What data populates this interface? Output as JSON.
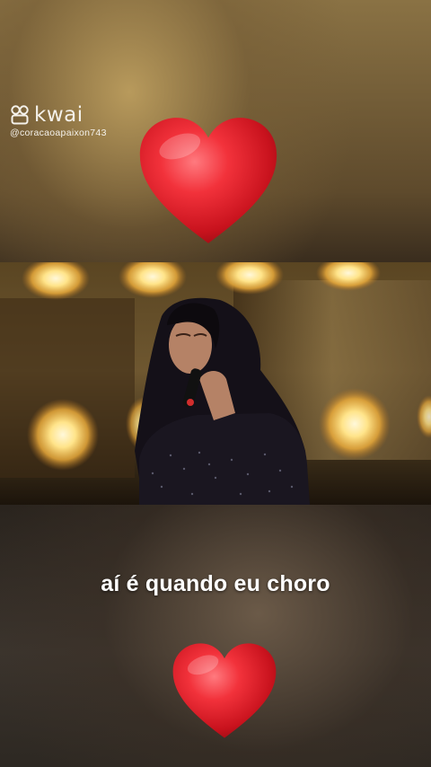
{
  "watermark": {
    "brand": "kwai",
    "handle": "@coracaoapaixon743",
    "logo_icon": "kwai-logo-icon"
  },
  "caption": {
    "text": "aí é quando eu choro"
  },
  "decorations": {
    "top_icon": "heart-icon",
    "bottom_icon": "heart-icon",
    "heart_color": "#e0222b"
  },
  "video": {
    "subject": "singer-with-microphone"
  }
}
